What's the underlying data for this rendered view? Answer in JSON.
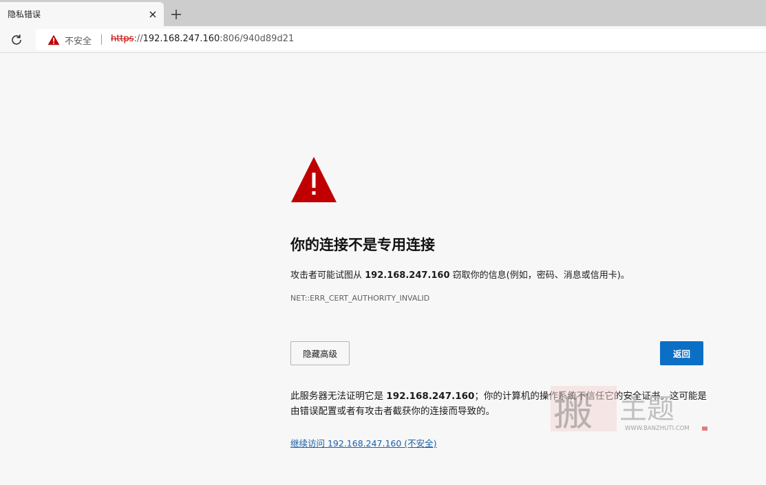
{
  "tab": {
    "title": "隐私错误"
  },
  "toolbar": {
    "insecure_label": "不安全",
    "url_scheme": "https",
    "url_sep": "://",
    "url_host": "192.168.247.160",
    "url_rest": ":806/940d89d21"
  },
  "page": {
    "heading": "你的连接不是专用连接",
    "desc_pre": "攻击者可能试图从 ",
    "desc_host": "192.168.247.160",
    "desc_post": " 窃取你的信息(例如，密码、消息或信用卡)。",
    "error_code": "NET::ERR_CERT_AUTHORITY_INVALID",
    "advanced_label": "隐藏高级",
    "back_label": "返回",
    "detail_pre": "此服务器无法证明它是 ",
    "detail_host": "192.168.247.160",
    "detail_post": "；你的计算机的操作系统不信任它的安全证书。这可能是由错误配置或者有攻击者截获你的连接而导致的。",
    "proceed_link": "继续访问 192.168.247.160 (不安全)"
  },
  "watermark": {
    "site": "WWW.BANZHUTI.COM"
  },
  "colors": {
    "warning_red": "#c00000",
    "primary_blue": "#0b6fc6",
    "link_blue": "#1a5fa8"
  }
}
